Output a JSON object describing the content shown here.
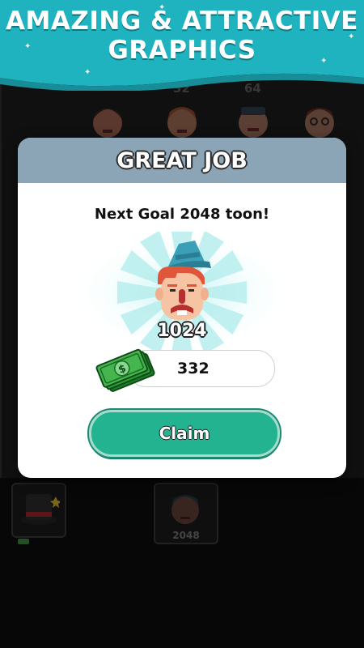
{
  "banner": {
    "line1": "AMAZING & ATTRACTIVE",
    "line2": "GRAPHICS",
    "color": "#1fb3bf"
  },
  "board": {
    "top_numbers": [
      "32",
      "64"
    ],
    "bottom_slot_label": "2048"
  },
  "dialog": {
    "title": "GREAT JOB",
    "goal_text": "Next Goal 2048 toon!",
    "character_level": "1024",
    "reward_amount": "332",
    "claim_label": "Claim",
    "header_color": "#8ba5b6",
    "button_color": "#23b391"
  },
  "icons": {
    "character": "red-haired-man-with-teal-hat",
    "reward": "cash-stack-dollar-icon"
  }
}
